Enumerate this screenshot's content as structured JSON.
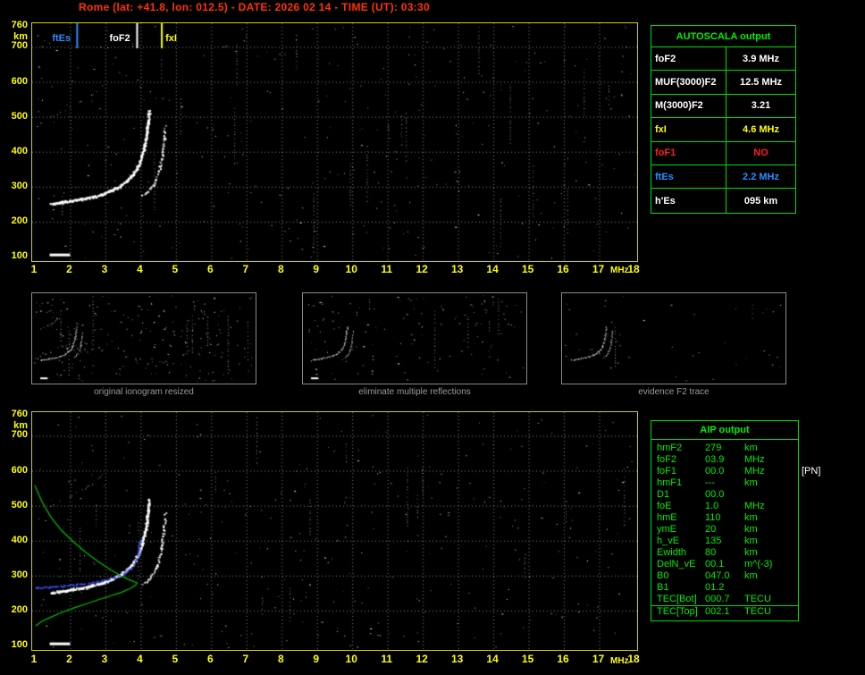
{
  "header": {
    "title": "Rome (lat: +41.8, lon: 012.5) - DATE: 2026 02 14 - TIME (UT): 03:30",
    "title_color": "#ff3300"
  },
  "colors": {
    "axis": "#ffff00",
    "frame": "#cccc00",
    "table_green": "#00dd00",
    "caption_gray": "#9a9a9a",
    "ftEs_blue": "#2e8bff",
    "foF1_red": "#ff2020",
    "fxI_yellow": "#ffff00",
    "profile_green": "#00c000",
    "fitted_blue": "#3c50ff"
  },
  "autoscala_table": {
    "title": "AUTOSCALA output",
    "rows": [
      {
        "label": "foF2",
        "value": "3.9 MHz",
        "color": "#ffffff"
      },
      {
        "label": "MUF(3000)F2",
        "value": "12.5 MHz",
        "color": "#ffffff"
      },
      {
        "label": "M(3000)F2",
        "value": "3.21",
        "color": "#ffffff"
      },
      {
        "label": "fxI",
        "value": "4.6 MHz",
        "color": "#ffff00"
      },
      {
        "label": "foF1",
        "value": "NO",
        "color": "#ff2020"
      },
      {
        "label": "ftEs",
        "value": "2.2 MHz",
        "color": "#2e8bff"
      },
      {
        "label": "h'Es",
        "value": "095  km",
        "color": "#ffffff"
      }
    ]
  },
  "thumbnails": [
    {
      "caption": "original ionogram resized"
    },
    {
      "caption": "eliminate multiple reflections"
    },
    {
      "caption": "evidence F2 trace"
    }
  ],
  "aip_table": {
    "title": "AIP output",
    "rows": [
      {
        "label": "hmF2",
        "value": "279",
        "unit": "km",
        "extra": ""
      },
      {
        "label": "foF2",
        "value": "03.9",
        "unit": "MHz",
        "extra": ""
      },
      {
        "label": "foF1",
        "value": "00.0",
        "unit": "MHz",
        "extra": "[PN]"
      },
      {
        "label": "hmF1",
        "value": "---",
        "unit": "km",
        "extra": ""
      },
      {
        "label": "D1",
        "value": "00.0",
        "unit": "",
        "extra": ""
      },
      {
        "label": "foE",
        "value": "1.0",
        "unit": "MHz",
        "extra": ""
      },
      {
        "label": "hmE",
        "value": "110",
        "unit": "km",
        "extra": ""
      },
      {
        "label": "ymE",
        "value": "20",
        "unit": "km",
        "extra": ""
      },
      {
        "label": "h_vE",
        "value": "135",
        "unit": "km",
        "extra": ""
      },
      {
        "label": "Ewidth",
        "value": "80",
        "unit": "km",
        "extra": ""
      },
      {
        "label": "DelN_vE",
        "value": "00.1",
        "unit": "m^(-3)",
        "extra": ""
      },
      {
        "label": "B0",
        "value": "047.0",
        "unit": "km",
        "extra": ""
      },
      {
        "label": "B1",
        "value": "01.2",
        "unit": "",
        "extra": ""
      },
      {
        "label": "TEC[Bot]",
        "value": "000.7",
        "unit": "TECU",
        "extra": ""
      },
      {
        "label": "TEC[Top]",
        "value": "002.1",
        "unit": "TECU",
        "extra": "",
        "separator_above": true
      }
    ]
  },
  "chart_data": [
    {
      "type": "scatter",
      "name": "autoscaled ionogram (virtual height vs frequency)",
      "title": "",
      "xlabel": "MHz",
      "ylabel": "km",
      "xlim": [
        1,
        18
      ],
      "ylim": [
        100,
        760
      ],
      "grid": true,
      "x_ticks": [
        1,
        2,
        3,
        4,
        5,
        6,
        7,
        8,
        9,
        10,
        11,
        12,
        13,
        14,
        15,
        16,
        17,
        18
      ],
      "y_ticks": [
        760,
        700,
        600,
        500,
        400,
        300,
        200,
        100
      ],
      "markers": [
        {
          "label": "ftEs",
          "freq": 2.2,
          "color": "#2e8bff",
          "label_dx": -28
        },
        {
          "label": "foF2",
          "freq": 3.9,
          "color": "#ffffff",
          "label_dx": -31
        },
        {
          "label": "fxI",
          "freq": 4.6,
          "color": "#ffff00",
          "label_dx": 4
        }
      ],
      "series": [
        {
          "name": "F2-ordinary",
          "render": "trace",
          "rgb": "255,255,255",
          "points": [
            [
              1.45,
              252
            ],
            [
              1.7,
              256
            ],
            [
              2.0,
              261
            ],
            [
              2.3,
              266
            ],
            [
              2.6,
              272
            ],
            [
              2.9,
              280
            ],
            [
              3.15,
              290
            ],
            [
              3.4,
              303
            ],
            [
              3.6,
              318
            ],
            [
              3.78,
              338
            ],
            [
              3.92,
              362
            ],
            [
              4.02,
              390
            ],
            [
              4.1,
              420
            ],
            [
              4.16,
              455
            ],
            [
              4.2,
              490
            ],
            [
              4.23,
              520
            ]
          ]
        },
        {
          "name": "F2-extraordinary",
          "render": "trace2",
          "rgb": "255,255,255",
          "points": [
            [
              4.05,
              275
            ],
            [
              4.2,
              288
            ],
            [
              4.33,
              305
            ],
            [
              4.44,
              328
            ],
            [
              4.53,
              358
            ],
            [
              4.6,
              395
            ],
            [
              4.65,
              435
            ],
            [
              4.68,
              478
            ]
          ]
        },
        {
          "name": "multiple-reflection",
          "render": "sparse",
          "rgb": "230,230,230",
          "points": [
            [
              1.45,
              500
            ],
            [
              1.7,
              512
            ],
            [
              2.0,
              527
            ],
            [
              2.3,
              544
            ],
            [
              2.6,
              563
            ],
            [
              2.9,
              588
            ]
          ]
        },
        {
          "name": "Es-layer",
          "render": "bar",
          "color": "#ffffff",
          "points": [
            [
              1.42,
              106
            ],
            [
              2.0,
              106
            ]
          ]
        }
      ]
    },
    {
      "type": "scatter",
      "name": "ionogram with inverted electron density profile",
      "title": "",
      "xlabel": "MHz",
      "ylabel": "km",
      "xlim": [
        1,
        18
      ],
      "ylim": [
        100,
        760
      ],
      "grid": true,
      "x_ticks": [
        1,
        2,
        3,
        4,
        5,
        6,
        7,
        8,
        9,
        10,
        11,
        12,
        13,
        14,
        15,
        16,
        17,
        18
      ],
      "y_ticks": [
        760,
        700,
        600,
        500,
        400,
        300,
        200,
        100
      ],
      "markers": [],
      "series": [
        {
          "name": "F2-ordinary",
          "render": "trace",
          "rgb": "255,255,255",
          "points": [
            [
              1.45,
              252
            ],
            [
              1.7,
              256
            ],
            [
              2.0,
              261
            ],
            [
              2.3,
              266
            ],
            [
              2.6,
              272
            ],
            [
              2.9,
              280
            ],
            [
              3.15,
              290
            ],
            [
              3.4,
              303
            ],
            [
              3.6,
              318
            ],
            [
              3.78,
              338
            ],
            [
              3.92,
              362
            ],
            [
              4.02,
              390
            ],
            [
              4.1,
              420
            ],
            [
              4.16,
              455
            ],
            [
              4.2,
              490
            ],
            [
              4.23,
              520
            ]
          ]
        },
        {
          "name": "F2-extraordinary",
          "render": "trace2",
          "rgb": "255,255,255",
          "points": [
            [
              4.05,
              275
            ],
            [
              4.2,
              288
            ],
            [
              4.33,
              305
            ],
            [
              4.44,
              328
            ],
            [
              4.53,
              358
            ],
            [
              4.6,
              395
            ],
            [
              4.65,
              435
            ],
            [
              4.68,
              478
            ]
          ]
        },
        {
          "name": "multiple-reflection",
          "render": "sparse",
          "rgb": "230,230,230",
          "points": [
            [
              1.45,
              500
            ],
            [
              1.7,
              512
            ],
            [
              2.0,
              527
            ],
            [
              2.3,
              544
            ],
            [
              2.6,
              563
            ],
            [
              2.9,
              588
            ]
          ]
        },
        {
          "name": "Es-layer",
          "render": "bar",
          "color": "#ffffff",
          "points": [
            [
              1.42,
              106
            ],
            [
              2.0,
              106
            ]
          ]
        },
        {
          "name": "electron-density-profile",
          "render": "line",
          "color": "#00c000",
          "points": [
            [
              1.0,
              558
            ],
            [
              1.2,
              512
            ],
            [
              1.45,
              468
            ],
            [
              1.75,
              430
            ],
            [
              2.1,
              396
            ],
            [
              2.45,
              366
            ],
            [
              2.8,
              340
            ],
            [
              3.15,
              317
            ],
            [
              3.45,
              299
            ],
            [
              3.7,
              287
            ],
            [
              3.85,
              281
            ],
            [
              3.9,
              279
            ],
            [
              3.85,
              272
            ],
            [
              3.7,
              263
            ],
            [
              3.45,
              252
            ],
            [
              3.15,
              242
            ],
            [
              2.8,
              231
            ],
            [
              2.45,
              219
            ],
            [
              2.1,
              207
            ],
            [
              1.75,
              194
            ],
            [
              1.45,
              181
            ],
            [
              1.2,
              169
            ],
            [
              1.02,
              156
            ]
          ]
        },
        {
          "name": "fitted-trace",
          "render": "fitted",
          "rgb": "60,80,255",
          "points": [
            [
              1.0,
              267
            ],
            [
              1.4,
              269
            ],
            [
              1.8,
              272
            ],
            [
              2.2,
              276
            ],
            [
              2.6,
              281
            ],
            [
              2.95,
              288
            ],
            [
              3.25,
              296
            ],
            [
              3.5,
              307
            ],
            [
              3.7,
              322
            ],
            [
              3.84,
              344
            ],
            [
              3.92,
              372
            ],
            [
              3.97,
              405
            ]
          ]
        }
      ]
    }
  ]
}
